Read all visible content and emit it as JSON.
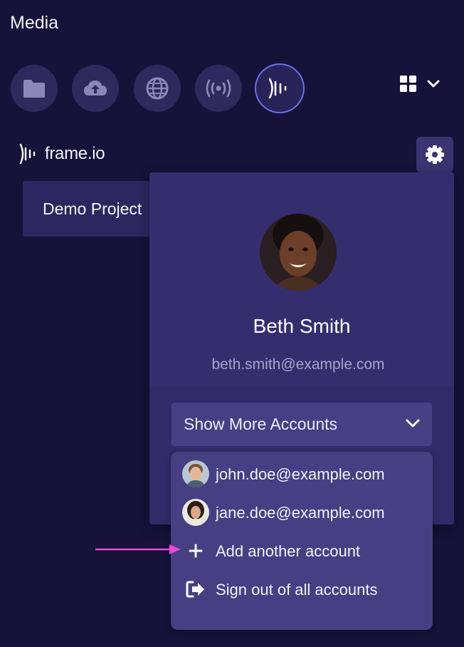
{
  "panel": {
    "title": "Media"
  },
  "sources": [
    {
      "icon": "folder-icon",
      "name": "local-files"
    },
    {
      "icon": "cloud-upload-icon",
      "name": "upload"
    },
    {
      "icon": "globe-icon",
      "name": "web"
    },
    {
      "icon": "broadcast-icon",
      "name": "live"
    },
    {
      "icon": "frameio-icon",
      "name": "frameio",
      "active": true
    }
  ],
  "brand": {
    "name": "frame.io"
  },
  "project": {
    "name": "Demo Project"
  },
  "profile": {
    "name": "Beth Smith",
    "email": "beth.smith@example.com"
  },
  "more_accounts": {
    "label": "Show More Accounts"
  },
  "accounts_menu": {
    "items": [
      {
        "label": "john.doe@example.com",
        "icon": "avatar"
      },
      {
        "label": "jane.doe@example.com",
        "icon": "avatar"
      },
      {
        "label": "Add another account",
        "icon": "plus-icon"
      },
      {
        "label": "Sign out of all accounts",
        "icon": "sign-out-icon"
      }
    ]
  },
  "colors": {
    "background": "#16123a",
    "popover": "#322b69",
    "menu": "#463f84",
    "active_ring": "#6b6ee6",
    "annotation_arrow": "#e84ad8"
  }
}
